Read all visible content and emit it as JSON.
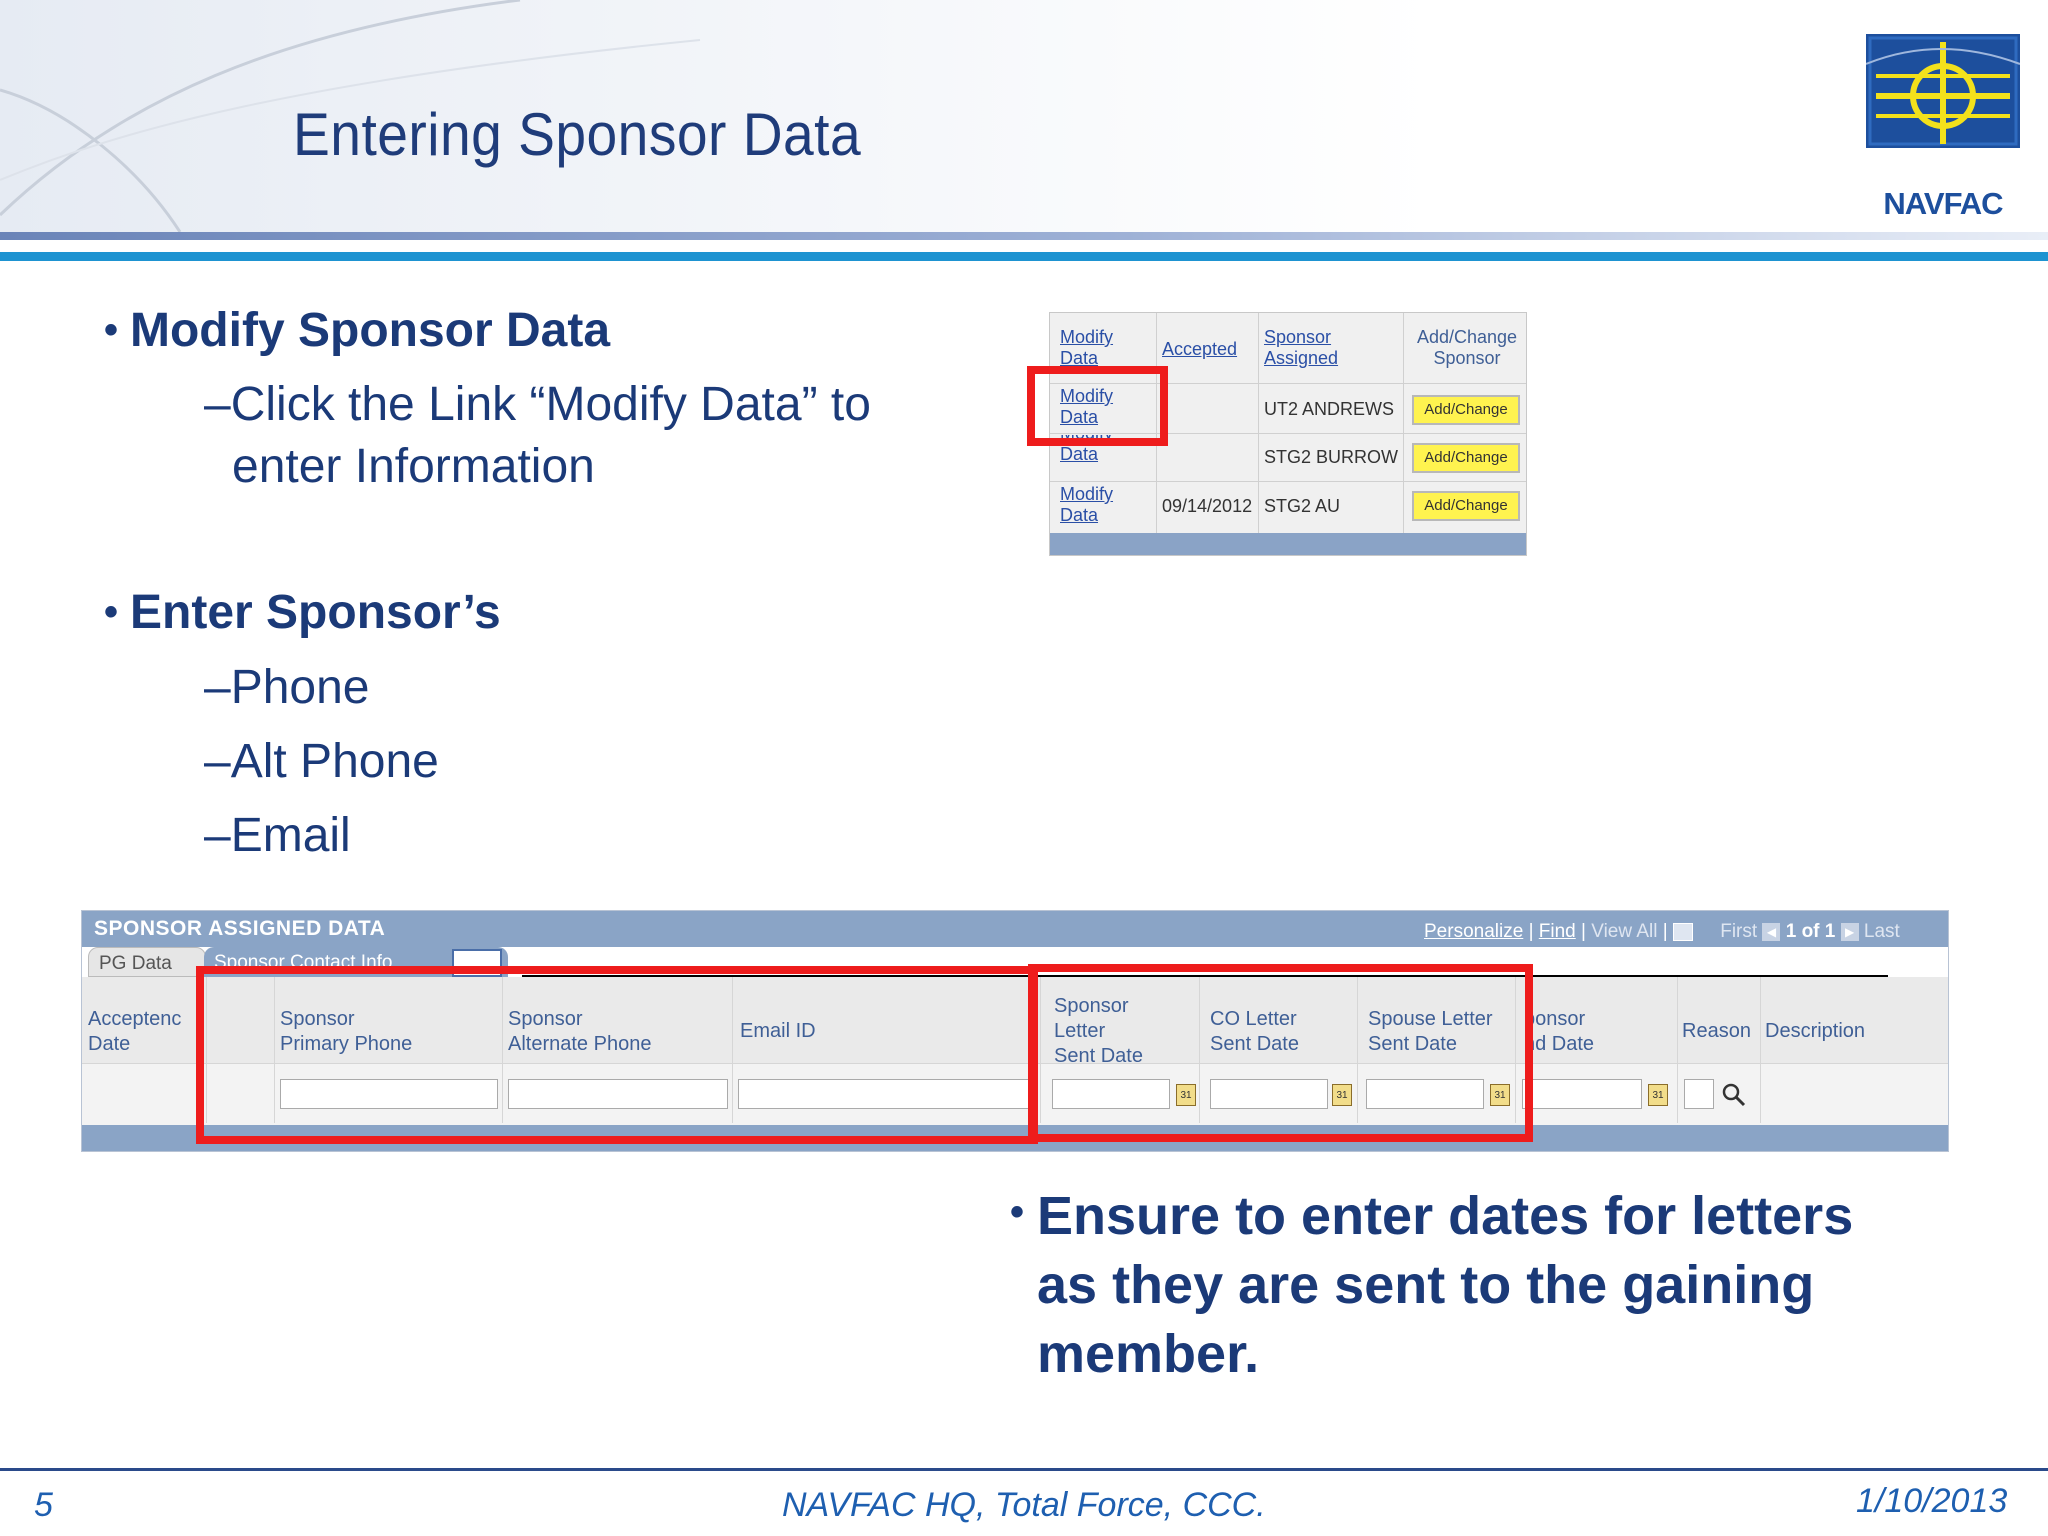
{
  "slide": {
    "title": "Entering Sponsor Data",
    "logo_text": "NAVFAC",
    "footer_page": "5",
    "footer_center": "NAVFAC HQ, Total Force, CCC.",
    "footer_date": "1/10/2013"
  },
  "bullets": {
    "b1_head": "Modify Sponsor Data",
    "b1_sub_line1": "–Click the Link “Modify Data” to",
    "b1_sub_line2": "enter Information",
    "b2_head": "Enter Sponsor’s",
    "b2_items": [
      "–Phone",
      "–Alt Phone",
      "–Email"
    ],
    "b3_line1": "Ensure to enter dates for letters",
    "b3_line2": "as they are sent to the gaining",
    "b3_line3": "member."
  },
  "mini_table": {
    "headers": {
      "modify": [
        "Modify",
        "Data"
      ],
      "accepted": "Accepted",
      "sponsor_assigned": [
        "Sponsor",
        "Assigned"
      ],
      "add_change": [
        "Add/Change",
        "Sponsor"
      ]
    },
    "rows": [
      {
        "modify": [
          "Modify",
          "Data"
        ],
        "accepted": "",
        "sponsor": "UT2 ANDREWS",
        "button": "Add/Change"
      },
      {
        "modify": [
          "Modify",
          "Data"
        ],
        "accepted": "",
        "sponsor": "STG2 BURROW",
        "button": "Add/Change"
      },
      {
        "modify": [
          "Modify",
          "Data"
        ],
        "accepted": "09/14/2012",
        "sponsor": "STG2 AU",
        "button": "Add/Change"
      }
    ]
  },
  "big_table": {
    "title": "SPONSOR ASSIGNED DATA",
    "toolbar": {
      "personalize": "Personalize",
      "find": "Find",
      "view_all": "View All",
      "first": "First",
      "page": "1 of 1",
      "last": "Last"
    },
    "tabs": [
      "PG Data",
      "Sponsor Contact Info"
    ],
    "columns": [
      [
        "Acceptenc",
        "Date"
      ],
      [
        "Sponsor",
        "Primary Phone"
      ],
      [
        "Sponsor",
        "Alternate Phone"
      ],
      [
        "Email ID"
      ],
      [
        "Sponsor",
        "Letter",
        "Sent Date"
      ],
      [
        "CO Letter",
        "Sent Date"
      ],
      [
        "Spouse Letter",
        "Sent Date"
      ],
      [
        "ponsor",
        "nd Date"
      ],
      [
        "Reason"
      ],
      [
        "Description"
      ]
    ],
    "calendar_glyph": "31"
  },
  "colors": {
    "title_blue": "#1f3c7a",
    "highlight_red": "#ee1c1c",
    "grid_bar": "#8aa4c6",
    "button_yellow": "#fff34f"
  }
}
